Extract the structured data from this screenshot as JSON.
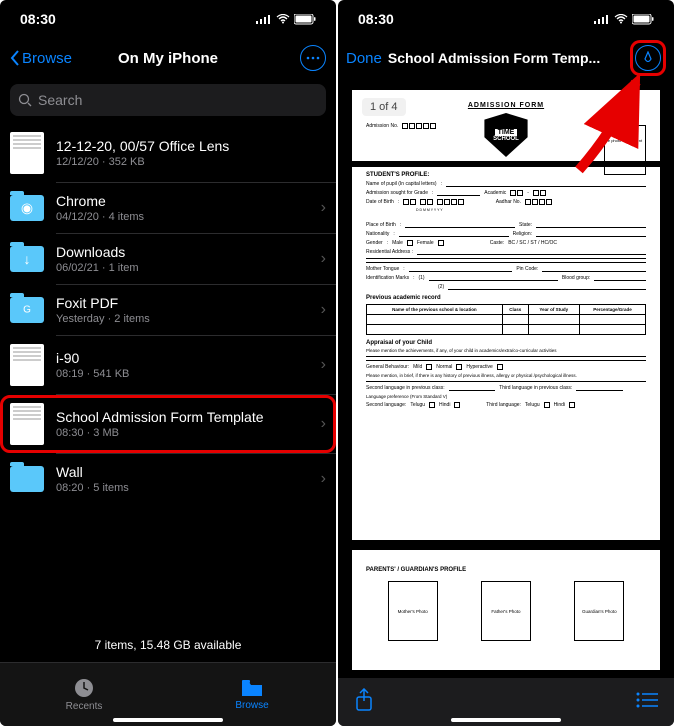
{
  "status": {
    "time": "08:30"
  },
  "left": {
    "back_label": "Browse",
    "title": "On My iPhone",
    "search_placeholder": "Search",
    "items": [
      {
        "title": "12-12-20, 00/57 Office Lens",
        "sub": "12/12/20 · 352 KB",
        "icon": "doc",
        "chevron": false
      },
      {
        "title": "Chrome",
        "sub": "04/12/20 · 4 items",
        "icon": "folder-chrome",
        "chevron": true
      },
      {
        "title": "Downloads",
        "sub": "06/02/21 · 1 item",
        "icon": "folder-download",
        "chevron": true
      },
      {
        "title": "Foxit PDF",
        "sub": "Yesterday · 2 items",
        "icon": "folder-foxit",
        "chevron": true
      },
      {
        "title": "i-90",
        "sub": "08:19 · 541 KB",
        "icon": "doc",
        "chevron": true
      },
      {
        "title": "School Admission Form Template",
        "sub": "08:30 · 3 MB",
        "icon": "doc",
        "chevron": true,
        "highlighted": true
      },
      {
        "title": "Wall",
        "sub": "08:20 · 5 items",
        "icon": "folder",
        "chevron": true
      }
    ],
    "footer": "7 items, 15.48 GB available",
    "tabs": {
      "recents": "Recents",
      "browse": "Browse"
    }
  },
  "right": {
    "done": "Done",
    "title": "School Admission Form Temp...",
    "page_indicator": "1 of 4",
    "form": {
      "heading": "ADMISSION FORM",
      "logo_top": "TIME",
      "logo_bottom": "SCHOOL",
      "photo_caption": "e photo the student",
      "admission_no": "Admission No.",
      "section_profile": "STUDENT'S PROFILE:",
      "name_pupil": "Name of pupil (In capital letters)",
      "adm_sought": "Admission sought for Grade",
      "academic": "Academic",
      "aadhar": "Aadhar No.",
      "dob": "Date of Birth",
      "dob_fmt": "D  D    M  M    Y  Y  Y  Y",
      "pob": "Place of Birth",
      "state": "State:",
      "nationality": "Nationality",
      "religion": "Religion:",
      "gender": "Gender",
      "male": "Male",
      "female": "Female",
      "caste": "Caste:",
      "caste_opts": "BC / SC / ST / HC/OC",
      "res_addr": "Residential Address :",
      "mother_tongue": "Mother Tongue",
      "pincode": "Pin Code:",
      "id_marks": "Identification Marks",
      "blood": "Blood group:",
      "m1": "(1)",
      "m2": "(2)",
      "prev_record": "Previous academic record",
      "th_school": "Name of the previous school & location",
      "th_class": "Class",
      "th_year": "Year of Study",
      "th_pct": "Percentage/Grade",
      "appraisal": "Appraisal of your Child",
      "appraisal_txt": "Please mention the achievements, if any, of your child in academics/extra/co-curricular activities",
      "gen_beh": "General Behaviour:",
      "mild": "Mild",
      "normal": "Normal",
      "hyper": "Hyperactive",
      "history_txt": "Please mention, in brief, if there is any history of previous illness, allergy or physical /psychological illness.",
      "sec_lang_prev": "Second language in previous class:",
      "third_lang_prev": "Third language in previous class:",
      "lang_pref": "Language preference (From Standard V)",
      "sec_lang": "Second language:",
      "third_lang": "Third language:",
      "telugu": "Telugu",
      "hindi": "Hindi",
      "parents_heading": "PARENTS' / GUARDIAN'S PROFILE",
      "mother_photo": "Mother's Photo",
      "father_photo": "Father's Photo",
      "guardian_photo": "Guardian's Photo"
    }
  }
}
